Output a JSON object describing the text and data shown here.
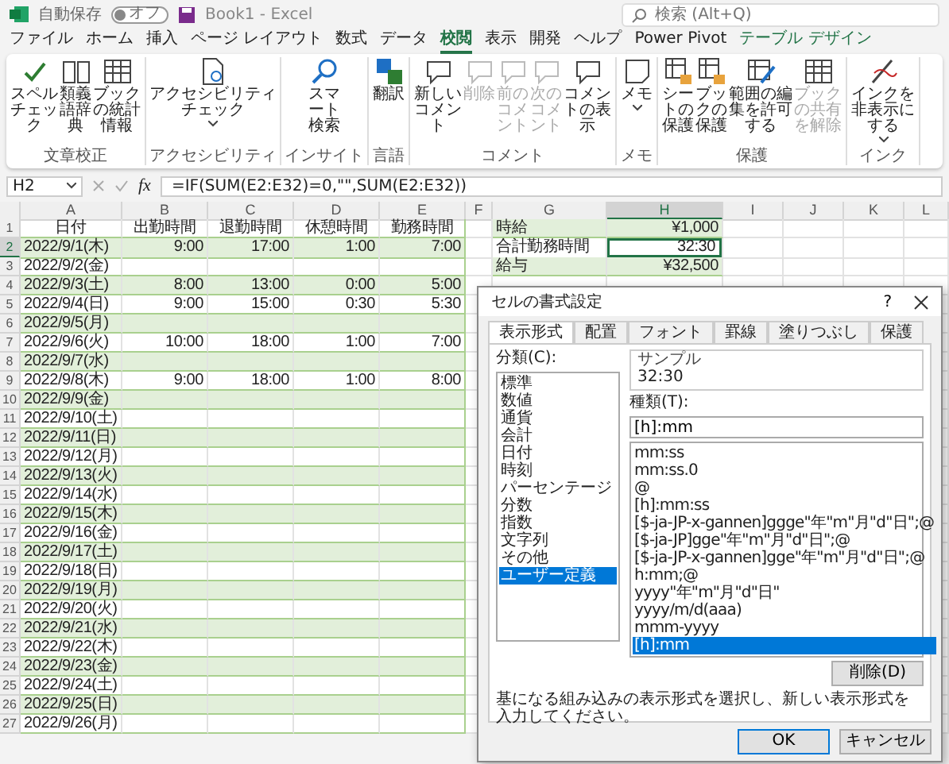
{
  "titlebar": {
    "autosave_label": "自動保存",
    "autosave_state": "オフ",
    "autosave_on": false,
    "doc_title": "Book1 - Excel",
    "search": {
      "placeholder": "検索 (Alt+Q)"
    }
  },
  "menu": [
    {
      "label": "ファイル",
      "selected": false,
      "kind": "normal"
    },
    {
      "label": "ホーム",
      "selected": false,
      "kind": "normal"
    },
    {
      "label": "挿入",
      "selected": false,
      "kind": "normal"
    },
    {
      "label": "ページ レイアウト",
      "selected": false,
      "kind": "normal"
    },
    {
      "label": "数式",
      "selected": false,
      "kind": "normal"
    },
    {
      "label": "データ",
      "selected": false,
      "kind": "normal"
    },
    {
      "label": "校閲",
      "selected": true,
      "kind": "normal"
    },
    {
      "label": "表示",
      "selected": false,
      "kind": "normal"
    },
    {
      "label": "開発",
      "selected": false,
      "kind": "normal"
    },
    {
      "label": "ヘルプ",
      "selected": false,
      "kind": "normal"
    },
    {
      "label": "Power Pivot",
      "selected": false,
      "kind": "normal"
    },
    {
      "label": "テーブル デザイン",
      "selected": false,
      "kind": "contextual"
    }
  ],
  "ribbon": [
    {
      "label": "文章校正",
      "buttons": [
        {
          "label": "スペルチェック",
          "kind": "check",
          "disabled": false,
          "dropdown": false
        },
        {
          "label": "類義語辞典",
          "kind": "book",
          "disabled": false,
          "dropdown": false
        },
        {
          "label": "ブックの統計情報",
          "kind": "grid",
          "disabled": false,
          "dropdown": false
        }
      ]
    },
    {
      "label": "アクセシビリティ",
      "buttons": [
        {
          "label": "アクセシビリティチェック",
          "kind": "doc",
          "disabled": false,
          "dropdown": true
        }
      ]
    },
    {
      "label": "インサイト",
      "buttons": [
        {
          "label": "スマート検索",
          "kind": "magnifier",
          "disabled": false,
          "dropdown": false
        }
      ]
    },
    {
      "label": "言語",
      "buttons": [
        {
          "label": "翻訳",
          "kind": "translate",
          "disabled": false,
          "dropdown": false
        }
      ]
    },
    {
      "label": "コメント",
      "buttons": [
        {
          "label": "新しいコメント",
          "kind": "comment",
          "disabled": false,
          "dropdown": false
        },
        {
          "label": "削除",
          "kind": "comment",
          "disabled": true,
          "dropdown": false
        },
        {
          "label": "前のコメント",
          "kind": "comment",
          "disabled": true,
          "dropdown": false
        },
        {
          "label": "次のコメント",
          "kind": "comment",
          "disabled": true,
          "dropdown": false
        },
        {
          "label": "コメントの表示",
          "kind": "comment",
          "disabled": false,
          "dropdown": false
        }
      ]
    },
    {
      "label": "メモ",
      "buttons": [
        {
          "label": "メモ",
          "kind": "note",
          "disabled": false,
          "dropdown": true
        }
      ]
    },
    {
      "label": "保護",
      "buttons": [
        {
          "label": "シートの保護",
          "kind": "lock",
          "disabled": false,
          "dropdown": false
        },
        {
          "label": "ブックの保護",
          "kind": "lock",
          "disabled": false,
          "dropdown": false
        },
        {
          "label": "範囲の編集を許可する",
          "kind": "pen",
          "disabled": false,
          "dropdown": false
        },
        {
          "label": "ブックの共有を解除",
          "kind": "grid",
          "disabled": true,
          "dropdown": false
        }
      ]
    },
    {
      "label": "インク",
      "buttons": [
        {
          "label": "インクを非表示にする",
          "kind": "ink",
          "disabled": false,
          "dropdown": true
        }
      ]
    }
  ],
  "formula_bar": {
    "name_box": "H2",
    "fx": "fx",
    "formula": "=IF(SUM(E2:E32)=0,\"\",SUM(E2:E32))"
  },
  "sheet": {
    "columns": [
      {
        "label": "A",
        "selected": false
      },
      {
        "label": "B",
        "selected": false
      },
      {
        "label": "C",
        "selected": false
      },
      {
        "label": "D",
        "selected": false
      },
      {
        "label": "E",
        "selected": false
      },
      {
        "label": "F",
        "selected": false
      },
      {
        "label": "G",
        "selected": false
      },
      {
        "label": "H",
        "selected": true
      },
      {
        "label": "I",
        "selected": false
      },
      {
        "label": "J",
        "selected": false
      },
      {
        "label": "K",
        "selected": false
      },
      {
        "label": "L",
        "selected": false
      }
    ],
    "rows": [
      {
        "num": "1",
        "selected": false,
        "cells": [
          "日付",
          "出勤時間",
          "退勤時間",
          "休憩時間",
          "勤務時間"
        ]
      },
      {
        "num": "2",
        "selected": true,
        "cells": [
          "2022/9/1(木)",
          "9:00",
          "17:00",
          "1:00",
          "7:00"
        ]
      },
      {
        "num": "3",
        "selected": false,
        "cells": [
          "2022/9/2(金)"
        ]
      },
      {
        "num": "4",
        "selected": false,
        "cells": [
          "2022/9/3(土)",
          "8:00",
          "13:00",
          "0:00",
          "5:00"
        ]
      },
      {
        "num": "5",
        "selected": false,
        "cells": [
          "2022/9/4(日)",
          "9:00",
          "15:00",
          "0:30",
          "5:30"
        ]
      },
      {
        "num": "6",
        "selected": false,
        "cells": [
          "2022/9/5(月)"
        ]
      },
      {
        "num": "7",
        "selected": false,
        "cells": [
          "2022/9/6(火)",
          "10:00",
          "18:00",
          "1:00",
          "7:00"
        ]
      },
      {
        "num": "8",
        "selected": false,
        "cells": [
          "2022/9/7(水)"
        ]
      },
      {
        "num": "9",
        "selected": false,
        "cells": [
          "2022/9/8(木)",
          "9:00",
          "18:00",
          "1:00",
          "8:00"
        ]
      },
      {
        "num": "10",
        "selected": false,
        "cells": [
          "2022/9/9(金)"
        ]
      },
      {
        "num": "11",
        "selected": false,
        "cells": [
          "2022/9/10(土)"
        ]
      },
      {
        "num": "12",
        "selected": false,
        "cells": [
          "2022/9/11(日)"
        ]
      },
      {
        "num": "13",
        "selected": false,
        "cells": [
          "2022/9/12(月)"
        ]
      },
      {
        "num": "14",
        "selected": false,
        "cells": [
          "2022/9/13(火)"
        ]
      },
      {
        "num": "15",
        "selected": false,
        "cells": [
          "2022/9/14(水)"
        ]
      },
      {
        "num": "16",
        "selected": false,
        "cells": [
          "2022/9/15(木)"
        ]
      },
      {
        "num": "17",
        "selected": false,
        "cells": [
          "2022/9/16(金)"
        ]
      },
      {
        "num": "18",
        "selected": false,
        "cells": [
          "2022/9/17(土)"
        ]
      },
      {
        "num": "19",
        "selected": false,
        "cells": [
          "2022/9/18(日)"
        ]
      },
      {
        "num": "20",
        "selected": false,
        "cells": [
          "2022/9/19(月)"
        ]
      },
      {
        "num": "21",
        "selected": false,
        "cells": [
          "2022/9/20(火)"
        ]
      },
      {
        "num": "22",
        "selected": false,
        "cells": [
          "2022/9/21(水)"
        ]
      },
      {
        "num": "23",
        "selected": false,
        "cells": [
          "2022/9/22(木)"
        ]
      },
      {
        "num": "24",
        "selected": false,
        "cells": [
          "2022/9/23(金)"
        ]
      },
      {
        "num": "25",
        "selected": false,
        "cells": [
          "2022/9/24(土)"
        ]
      },
      {
        "num": "26",
        "selected": false,
        "cells": [
          "2022/9/25(日)"
        ]
      },
      {
        "num": "27",
        "selected": false,
        "cells": [
          "2022/9/26(月)"
        ]
      }
    ],
    "side_table": [
      {
        "label": "時給",
        "value": "¥1,000",
        "selected": false
      },
      {
        "label": "合計勤務時間",
        "value": "32:30",
        "selected": true
      },
      {
        "label": "給与",
        "value": "¥32,500",
        "selected": false
      }
    ]
  },
  "dialog": {
    "title": "セルの書式設定",
    "help": "?",
    "tabs": [
      {
        "label": "表示形式",
        "selected": true
      },
      {
        "label": "配置",
        "selected": false
      },
      {
        "label": "フォント",
        "selected": false
      },
      {
        "label": "罫線",
        "selected": false
      },
      {
        "label": "塗りつぶし",
        "selected": false
      },
      {
        "label": "保護",
        "selected": false
      }
    ],
    "category_label": "分類(C):",
    "categories": [
      {
        "label": "標準",
        "selected": false
      },
      {
        "label": "数値",
        "selected": false
      },
      {
        "label": "通貨",
        "selected": false
      },
      {
        "label": "会計",
        "selected": false
      },
      {
        "label": "日付",
        "selected": false
      },
      {
        "label": "時刻",
        "selected": false
      },
      {
        "label": "パーセンテージ",
        "selected": false
      },
      {
        "label": "分数",
        "selected": false
      },
      {
        "label": "指数",
        "selected": false
      },
      {
        "label": "文字列",
        "selected": false
      },
      {
        "label": "その他",
        "selected": false
      },
      {
        "label": "ユーザー定義",
        "selected": true
      }
    ],
    "sample_label": "サンプル",
    "sample": "32:30",
    "type_label": "種類(T):",
    "type_value": "[h]:mm",
    "formats": [
      {
        "label": "mm:ss",
        "selected": false
      },
      {
        "label": "mm:ss.0",
        "selected": false
      },
      {
        "label": "@",
        "selected": false
      },
      {
        "label": "[h]:mm:ss",
        "selected": false
      },
      {
        "label": "[$-ja-JP-x-gannen]ggge\"年\"m\"月\"d\"日\";@",
        "selected": false
      },
      {
        "label": "[$-ja-JP]gge\"年\"m\"月\"d\"日\";@",
        "selected": false
      },
      {
        "label": "[$-ja-JP-x-gannen]gge\"年\"m\"月\"d\"日\";@",
        "selected": false
      },
      {
        "label": "h:mm;@",
        "selected": false
      },
      {
        "label": "yyyy\"年\"m\"月\"d\"日\"",
        "selected": false
      },
      {
        "label": "yyyy/m/d(aaa)",
        "selected": false
      },
      {
        "label": "mmm-yyyy",
        "selected": false
      },
      {
        "label": "[h]:mm",
        "selected": true
      }
    ],
    "delete_button": "削除(D)",
    "description": "基になる組み込みの表示形式を選択し、新しい表示形式を入力してください。",
    "buttons": [
      {
        "label": "OK",
        "kind": "primary"
      },
      {
        "label": "キャンセル",
        "kind": "normal"
      }
    ]
  }
}
